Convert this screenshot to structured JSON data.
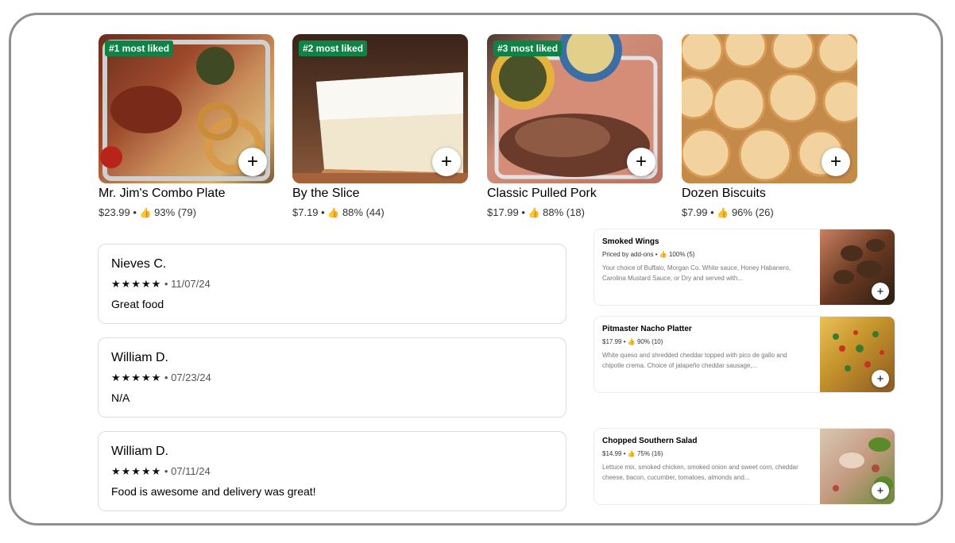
{
  "popular": [
    {
      "badge": "#1 most liked",
      "title": "Mr. Jim's Combo Plate",
      "price": "$23.99",
      "rating": "93% (79)",
      "add": "+"
    },
    {
      "badge": "#2 most liked",
      "title": "By the Slice",
      "price": "$7.19",
      "rating": "88% (44)",
      "add": "+"
    },
    {
      "badge": "#3 most liked",
      "title": "Classic Pulled Pork",
      "price": "$17.99",
      "rating": "88% (18)",
      "add": "+"
    },
    {
      "badge": "",
      "title": "Dozen Biscuits",
      "price": "$7.99",
      "rating": "96% (26)",
      "add": "+"
    }
  ],
  "separator": "•",
  "thumb_icon": "thumbs-up-icon",
  "reviews": [
    {
      "name": "Nieves C.",
      "stars": "★★★★★",
      "date": "11/07/24",
      "text": "Great food"
    },
    {
      "name": "William D.",
      "stars": "★★★★★",
      "date": "07/23/24",
      "text": "N/A"
    },
    {
      "name": "William D.",
      "stars": "★★★★★",
      "date": "07/11/24",
      "text": "Food is awesome and delivery was great!"
    }
  ],
  "menu_items": [
    {
      "name": "Smoked Wings",
      "price": "Priced by add-ons",
      "rating": "100% (5)",
      "desc": "Your choice of Buffalo, Morgan Co. White sauce, Honey Habanero, Carolina Mustard Sauce, or Dry and served with...",
      "add": "+"
    },
    {
      "name": "Pitmaster Nacho Platter",
      "price": "$17.99",
      "rating": "90% (10)",
      "desc": "White queso and shredded cheddar topped with pico de gallo and chipotle crema. Choice of jalapeño cheddar sausage,...",
      "add": "+"
    },
    {
      "name": "Chopped Southern Salad",
      "price": "$14.99",
      "rating": "75% (16)",
      "desc": "Lettuce mix, smoked chicken, smoked onion and sweet corn, cheddar cheese, bacon, cucumber, tomatoes, almonds and...",
      "add": "+"
    }
  ],
  "colors": {
    "badge_bg": "#0e8345",
    "frame_border": "#8f8f8f"
  }
}
